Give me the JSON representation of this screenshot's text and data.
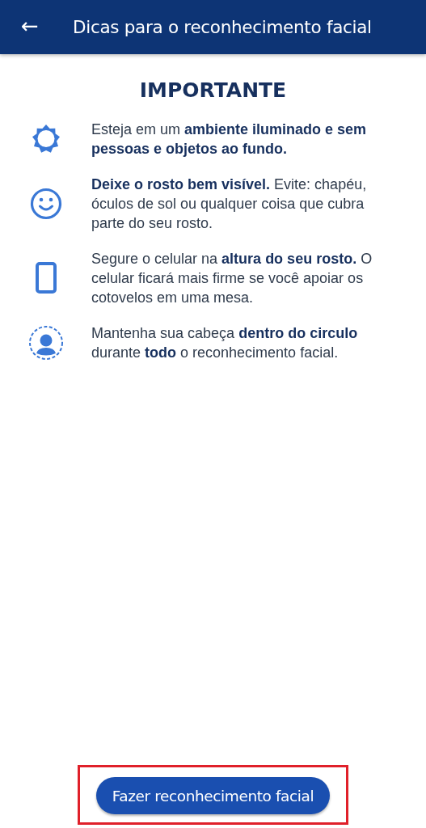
{
  "header": {
    "back": "←",
    "title": "Dicas para o reconhecimento facial"
  },
  "heading": "IMPORTANTE",
  "tips": [
    {
      "kind": "sun",
      "text": "Esteja em um **ambiente iluminado e sem pessoas e objetos ao fundo.**"
    },
    {
      "kind": "face",
      "text": "**Deixe o rosto bem visível.** Evite: chapéu, óculos de sol ou qualquer coisa que cubra parte do seu rosto."
    },
    {
      "kind": "phone",
      "text": "Segure o celular na **altura do seu rosto.** O celular ficará mais firme se você apoiar os cotovelos em uma mesa."
    },
    {
      "kind": "person",
      "text": "Mantenha sua cabeça **dentro do circulo** durante **todo** o reconhecimento facial."
    }
  ],
  "button": {
    "label": "Fazer reconhecimento facial",
    "highlighted": true
  }
}
